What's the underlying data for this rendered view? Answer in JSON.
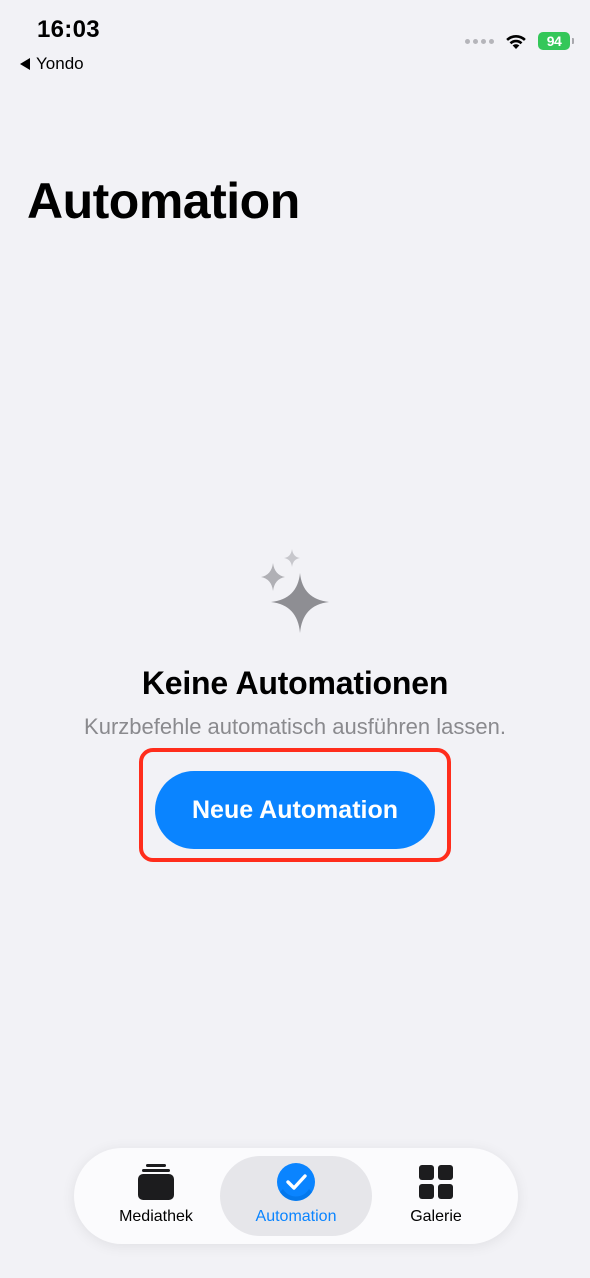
{
  "status_bar": {
    "time": "16:03",
    "back_app": "Yondo",
    "battery": "94"
  },
  "page": {
    "title": "Automation"
  },
  "empty_state": {
    "icon": "sparkles-icon",
    "title": "Keine Automationen",
    "subtitle": "Kurzbefehle automatisch ausführen lassen.",
    "button_label": "Neue Automation"
  },
  "tab_bar": {
    "tabs": [
      {
        "label": "Mediathek",
        "icon": "stack-icon",
        "active": false
      },
      {
        "label": "Automation",
        "icon": "checkmark-clock-icon",
        "active": true
      },
      {
        "label": "Galerie",
        "icon": "grid-icon",
        "active": false
      }
    ]
  },
  "colors": {
    "accent": "#0a84ff",
    "highlight": "#ff2d1c",
    "background": "#f2f2f6",
    "battery": "#34c759"
  }
}
